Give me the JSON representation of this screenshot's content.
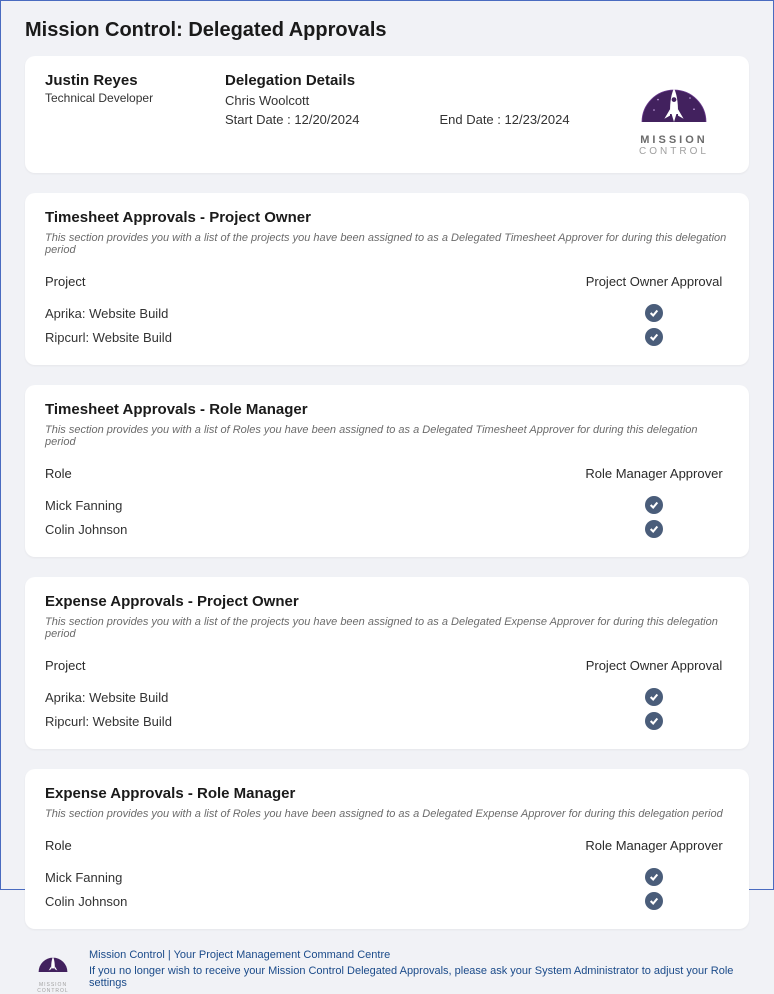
{
  "page_title": "Mission Control: Delegated Approvals",
  "user": {
    "name": "Justin Reyes",
    "title": "Technical Developer"
  },
  "delegation": {
    "heading": "Delegation Details",
    "delegate_name": "Chris Woolcott",
    "start_label": "Start Date :",
    "start_date": "12/20/2024",
    "end_label": "End Date :",
    "end_date": "12/23/2024"
  },
  "logo": {
    "line1": "MISSION",
    "line2": "CONTROL"
  },
  "sections": {
    "tspo": {
      "title": "Timesheet Approvals - Project Owner",
      "desc": "This section provides you with a list of the projects you have been assigned to as a Delegated Timesheet Approver for during this delegation period",
      "col1": "Project",
      "col2": "Project Owner Approval",
      "rows": [
        {
          "name": "Aprika: Website Build",
          "approved": true
        },
        {
          "name": "Ripcurl: Website Build",
          "approved": true
        }
      ]
    },
    "tsrm": {
      "title": "Timesheet Approvals - Role Manager",
      "desc": "This section provides you with a list of Roles you have been assigned to as a Delegated Timesheet Approver for during this delegation period",
      "col1": "Role",
      "col2": "Role Manager Approver",
      "rows": [
        {
          "name": "Mick Fanning",
          "approved": true
        },
        {
          "name": "Colin Johnson",
          "approved": true
        }
      ]
    },
    "expo": {
      "title": "Expense Approvals - Project Owner",
      "desc": "This section provides you with a list of the projects you have been assigned to as a Delegated Expense Approver for during this delegation period",
      "col1": "Project",
      "col2": "Project Owner Approval",
      "rows": [
        {
          "name": "Aprika: Website Build",
          "approved": true
        },
        {
          "name": "Ripcurl: Website Build",
          "approved": true
        }
      ]
    },
    "exrm": {
      "title": "Expense Approvals - Role Manager",
      "desc": "This section provides you with a list of Roles you have been assigned to as a Delegated Expense Approver for during this delegation period",
      "col1": "Role",
      "col2": "Role Manager Approver",
      "rows": [
        {
          "name": "Mick Fanning",
          "approved": true
        },
        {
          "name": "Colin Johnson",
          "approved": true
        }
      ]
    }
  },
  "footer": {
    "line1": "Mission Control | Your Project Management Command Centre",
    "line2": "If you no longer wish to receive your Mission Control Delegated Approvals, please ask your System Administrator to adjust your Role settings"
  }
}
